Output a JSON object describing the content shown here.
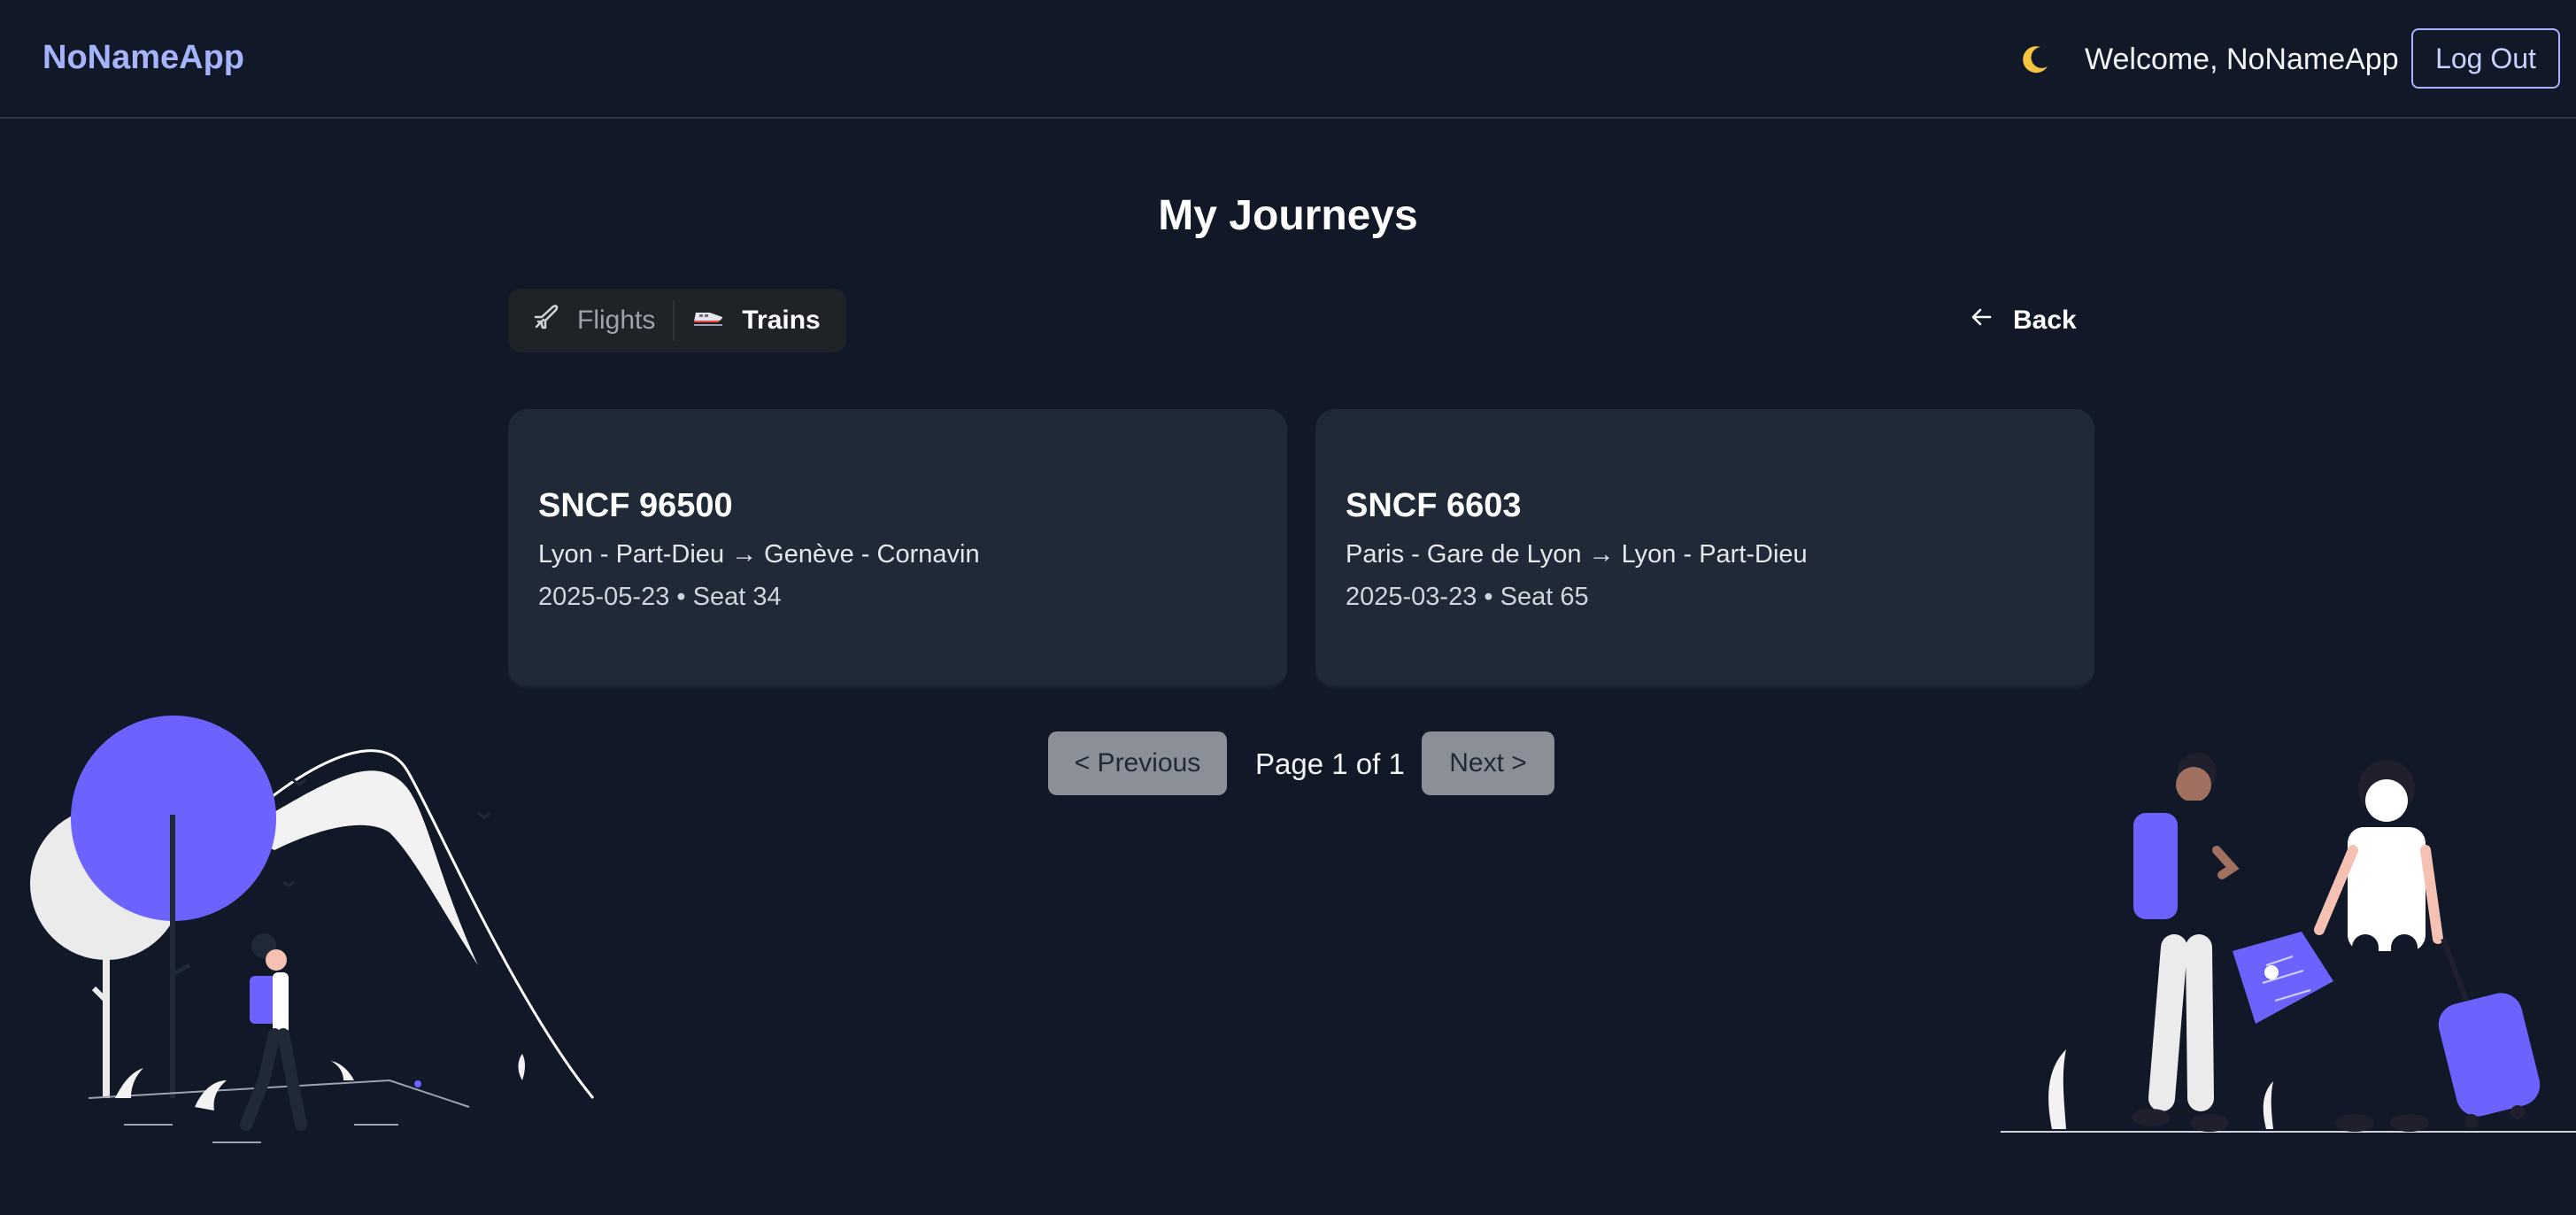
{
  "nav": {
    "brand": "NoNameApp",
    "theme_toggle_glyph": "🌙",
    "welcome_text": "Welcome, NoNameApp",
    "logout_label": "Log Out"
  },
  "main": {
    "title": "My Journeys",
    "tabs": [
      {
        "label": "Flights",
        "icon": "plane-icon",
        "active": false
      },
      {
        "label": "Trains",
        "icon": "train-icon",
        "active": true
      }
    ],
    "back_label": "Back",
    "journeys": [
      {
        "train": "SNCF 96500",
        "route": "Lyon - Part-Dieu → Genève - Cornavin",
        "meta": "2025-05-23 • Seat 34"
      },
      {
        "train": "SNCF 6603",
        "route": "Paris - Gare de Lyon → Lyon - Part-Dieu",
        "meta": "2025-03-23 • Seat 65"
      }
    ],
    "pagination": {
      "previous_label": "< Previous",
      "page_text": "Page 1 of 1",
      "next_label": "Next >"
    }
  },
  "colors": {
    "background": "#111827",
    "brand": "#a5b4fc",
    "card": "#1f2937",
    "accent_purple": "#6c63ff"
  }
}
